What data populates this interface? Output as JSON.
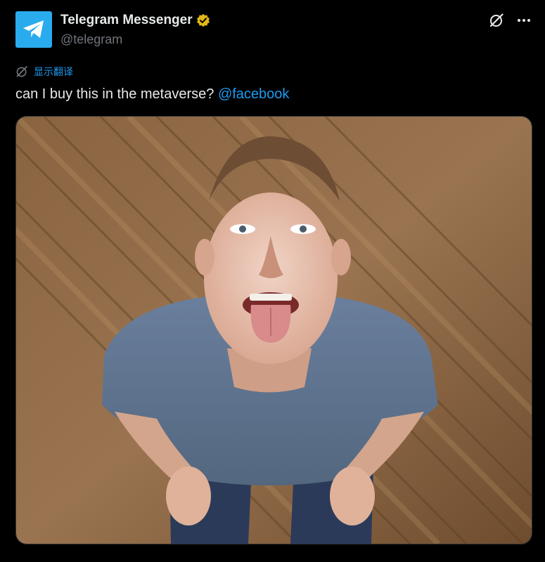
{
  "user": {
    "display_name": "Telegram Messenger",
    "handle": "@telegram",
    "verified": true,
    "avatar_icon": "telegram-paper-plane-icon"
  },
  "actions": {
    "grok_icon": "grok-icon",
    "more_icon": "more-dots-icon"
  },
  "translate": {
    "label": "显示翻译",
    "icon": "grok-icon"
  },
  "tweet": {
    "text": "can I buy this in the metaverse?",
    "mention": "@facebook"
  },
  "media": {
    "type": "photo",
    "icon": "photo"
  },
  "colors": {
    "background": "#000000",
    "text": "#e7e9ea",
    "secondary_text": "#71767b",
    "link": "#1d9bf0",
    "telegram_blue": "#2aabee",
    "verified_gold": "#e2b719"
  }
}
